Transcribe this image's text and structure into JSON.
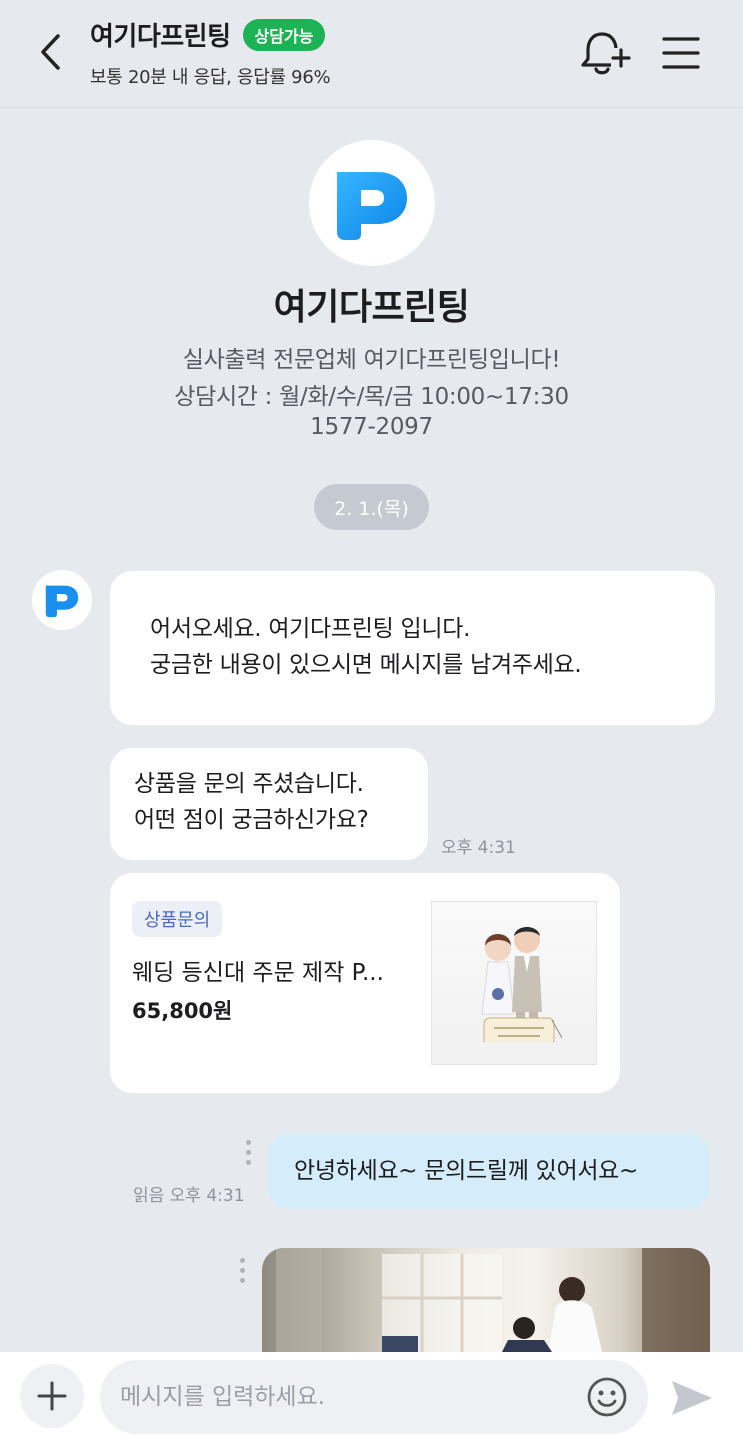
{
  "header": {
    "title": "여기다프린팅",
    "status_badge": "상담가능",
    "subtitle": "보통 20분 내 응답, 응답률 96%",
    "icons": [
      "back-icon",
      "bell-plus-icon",
      "menu-icon"
    ]
  },
  "profile": {
    "logo_letter": "P",
    "name": "여기다프린팅",
    "desc_line1": "실사출력 전문업체 여기다프린팅입니다!",
    "desc_line2": "상담시간 : 월/화/수/목/금 10:00~17:30",
    "phone": "1577-2097"
  },
  "date_chip": "2. 1.(목)",
  "messages": {
    "greeting_line1": "어서오세요. 여기다프린팅 입니다.",
    "greeting_line2": "궁금한 내용이 있으시면 메시지를 남겨주세요.",
    "inquiry_line1": "상품을 문의 주셨습니다.",
    "inquiry_line2": "어떤 점이 궁금하신가요?",
    "inquiry_time": "오후 4:31",
    "product": {
      "tag": "상품문의",
      "name": "웨딩 등신대 주문 제작 P...",
      "price": "65,800원"
    },
    "outgoing_text": "안녕하세요~ 문의드릴께 있어서요~",
    "outgoing_meta": "읽음 오후 4:31"
  },
  "composer": {
    "placeholder": "메시지를 입력하세요."
  },
  "colors": {
    "background": "#e6e9ee",
    "badge_green": "#1db254",
    "brand_blue": "#1a8ff0",
    "outgoing_bubble": "#d5ecfa"
  }
}
